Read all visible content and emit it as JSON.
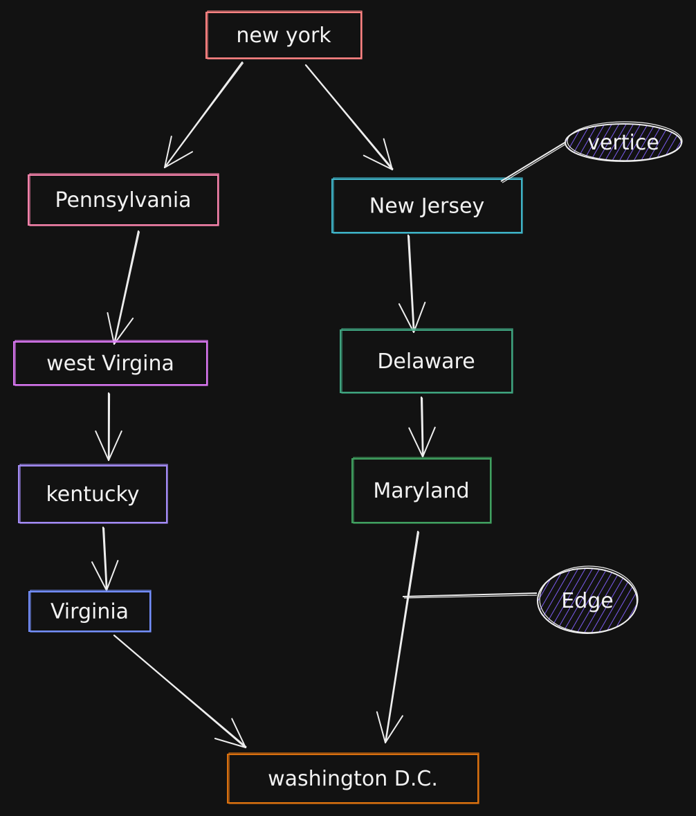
{
  "colors": {
    "background": "#121212",
    "stroke": "#eeeeee",
    "hatch": "#7c5cf0"
  },
  "nodes": [
    {
      "id": "ny",
      "label": "new york",
      "color": "#ff8383"
    },
    {
      "id": "pa",
      "label": "Pennsylvania",
      "color": "#f783ac"
    },
    {
      "id": "nj",
      "label": "New Jersey",
      "color": "#3fb3c7"
    },
    {
      "id": "wv",
      "label": "west Virgina",
      "color": "#da77f2"
    },
    {
      "id": "de",
      "label": "Delaware",
      "color": "#3fa37f"
    },
    {
      "id": "ky",
      "label": "kentucky",
      "color": "#a38bf5"
    },
    {
      "id": "md",
      "label": "Maryland",
      "color": "#40a060"
    },
    {
      "id": "va",
      "label": "Virginia",
      "color": "#748ffc"
    },
    {
      "id": "dc",
      "label": "washington D.C.",
      "color": "#d9700f"
    }
  ],
  "edges": [
    {
      "from": "ny",
      "to": "pa"
    },
    {
      "from": "ny",
      "to": "nj"
    },
    {
      "from": "pa",
      "to": "wv"
    },
    {
      "from": "wv",
      "to": "ky"
    },
    {
      "from": "ky",
      "to": "va"
    },
    {
      "from": "va",
      "to": "dc"
    },
    {
      "from": "nj",
      "to": "de"
    },
    {
      "from": "de",
      "to": "md"
    },
    {
      "from": "md",
      "to": "dc"
    }
  ],
  "annotations": [
    {
      "id": "vertice",
      "label": "vertice",
      "points_to": "nj"
    },
    {
      "id": "edge",
      "label": "Edge",
      "points_to": "md-dc edge"
    }
  ]
}
